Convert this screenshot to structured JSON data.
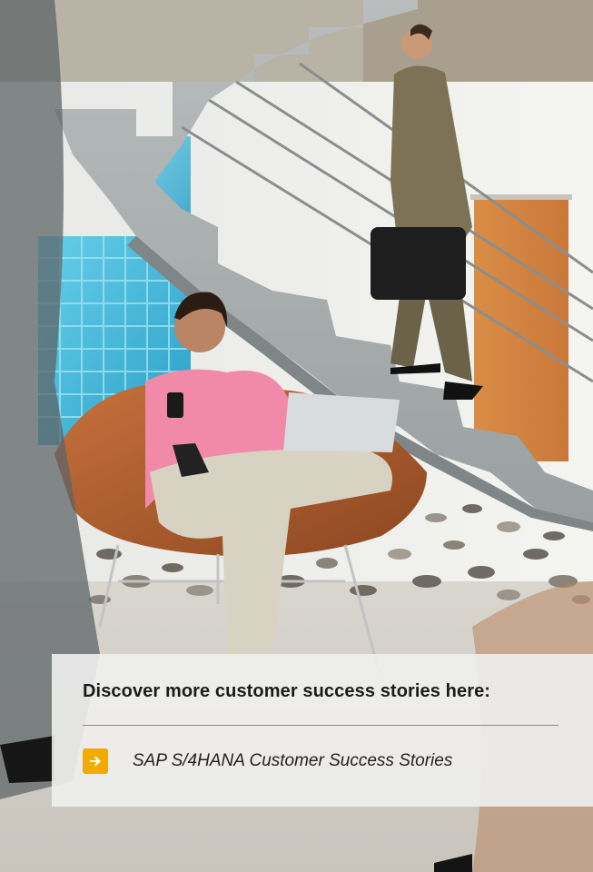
{
  "card": {
    "title": "Discover more customer success stories here:",
    "link_label": "SAP S/4HANA Customer Success Stories"
  },
  "icons": {
    "arrow": "arrow-right-icon"
  },
  "colors": {
    "accent": "#f0ab00",
    "card_bg": "#f0f0ee",
    "text": "#1b1b1b"
  }
}
